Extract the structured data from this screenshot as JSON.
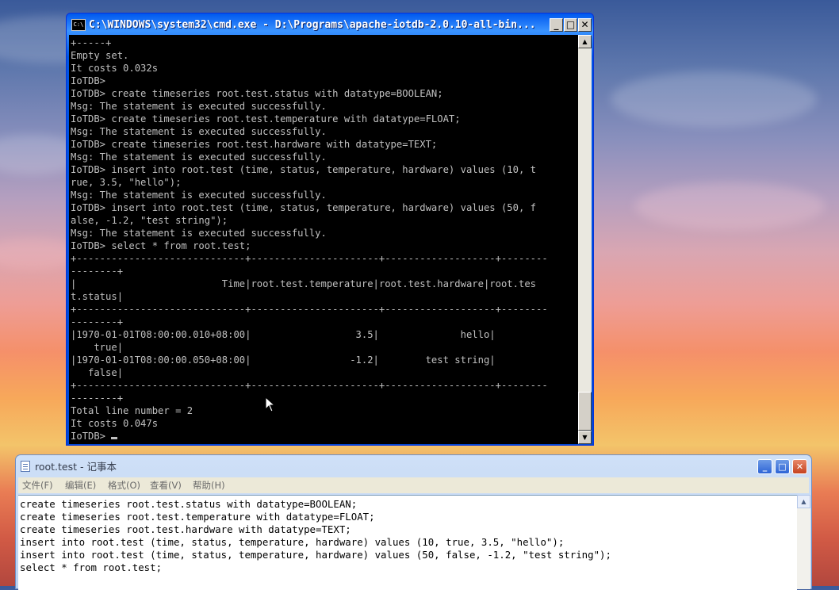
{
  "cmd": {
    "icon_text": "C:\\",
    "title": "C:\\WINDOWS\\system32\\cmd.exe - D:\\Programs\\apache-iotdb-2.0.10-all-bin...",
    "minimize": "_",
    "maximize": "□",
    "close": "✕",
    "console_lines": [
      "+-----+",
      "Empty set.",
      "It costs 0.032s",
      "IoTDB>",
      "IoTDB> create timeseries root.test.status with datatype=BOOLEAN;",
      "Msg: The statement is executed successfully.",
      "IoTDB> create timeseries root.test.temperature with datatype=FLOAT;",
      "Msg: The statement is executed successfully.",
      "IoTDB> create timeseries root.test.hardware with datatype=TEXT;",
      "Msg: The statement is executed successfully.",
      "IoTDB> insert into root.test (time, status, temperature, hardware) values (10, t",
      "rue, 3.5, \"hello\");",
      "Msg: The statement is executed successfully.",
      "IoTDB> insert into root.test (time, status, temperature, hardware) values (50, f",
      "alse, -1.2, \"test string\");",
      "Msg: The statement is executed successfully.",
      "IoTDB> select * from root.test;",
      "+-----------------------------+----------------------+-------------------+--------",
      "--------+",
      "|                         Time|root.test.temperature|root.test.hardware|root.tes",
      "t.status|",
      "+-----------------------------+----------------------+-------------------+--------",
      "--------+",
      "|1970-01-01T08:00:00.010+08:00|                  3.5|              hello|",
      "    true|",
      "|1970-01-01T08:00:00.050+08:00|                 -1.2|        test string|",
      "   false|",
      "+-----------------------------+----------------------+-------------------+--------",
      "--------+",
      "Total line number = 2",
      "It costs 0.047s"
    ],
    "prompt": "IoTDB> ",
    "scroll_up": "▲",
    "scroll_down": "▼"
  },
  "notepad": {
    "title": "root.test - 记事本",
    "minimize": "_",
    "maximize": "□",
    "close": "✕",
    "menus": [
      "文件(F)",
      "编辑(E)",
      "格式(O)",
      "查看(V)",
      "帮助(H)"
    ],
    "lines": [
      "create timeseries root.test.status with datatype=BOOLEAN;",
      "create timeseries root.test.temperature with datatype=FLOAT;",
      "create timeseries root.test.hardware with datatype=TEXT;",
      "insert into root.test (time, status, temperature, hardware) values (10, true, 3.5, \"hello\");",
      "insert into root.test (time, status, temperature, hardware) values (50, false, -1.2, \"test string\");",
      "select * from root.test;"
    ],
    "scroll_up": "▲"
  }
}
